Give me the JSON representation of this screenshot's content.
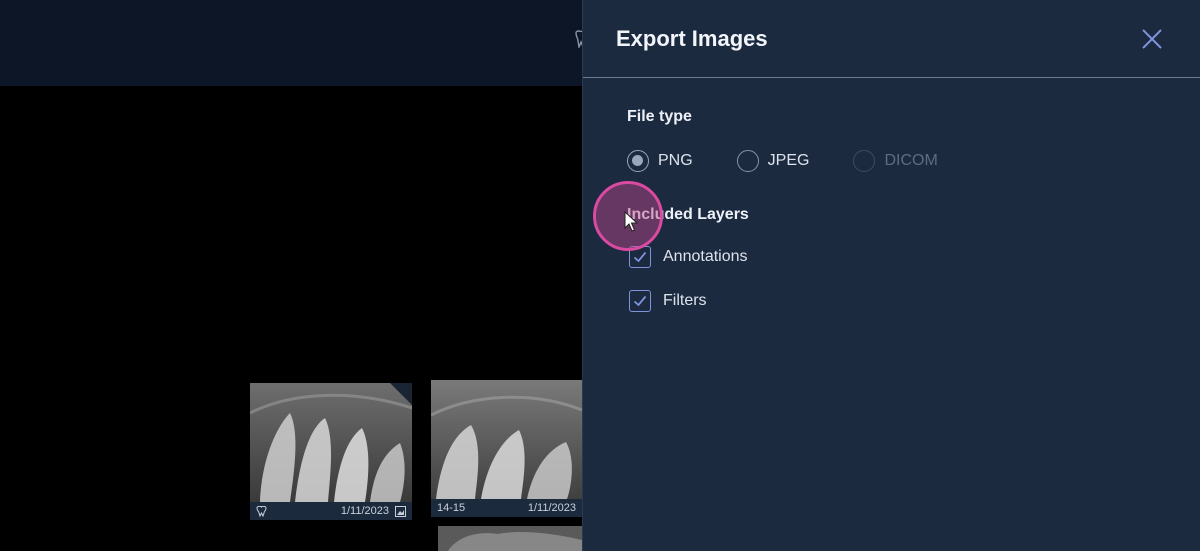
{
  "dialog": {
    "title": "Export Images",
    "file_type_label": "File type",
    "file_types": [
      {
        "label": "PNG",
        "state": "selected"
      },
      {
        "label": "JPEG",
        "state": "unselected"
      },
      {
        "label": "DICOM",
        "state": "disabled"
      }
    ],
    "layers_label": "Included Layers",
    "layers": [
      {
        "label": "Annotations",
        "checked": true
      },
      {
        "label": "Filters",
        "checked": true
      }
    ]
  },
  "thumbnails": [
    {
      "tooth": "",
      "date": "1/11/2023"
    },
    {
      "tooth": "14-15",
      "date": "1/11/2023"
    }
  ],
  "colors": {
    "panel_bg": "#1c2a40",
    "accent": "#7d93dc",
    "cursor_highlight": "#d94aa0"
  }
}
